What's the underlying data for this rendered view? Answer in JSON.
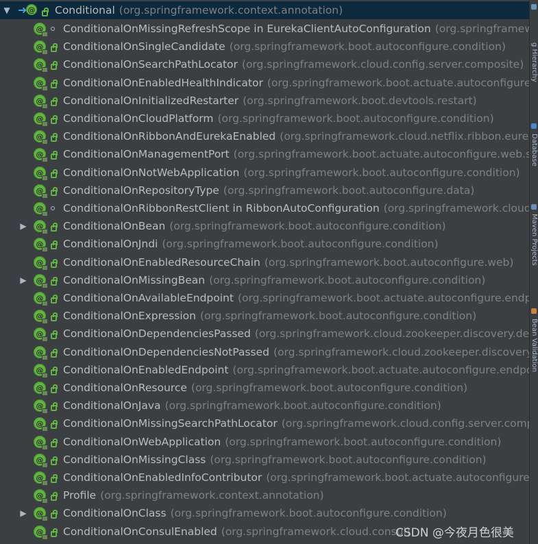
{
  "root": {
    "name": "Conditional",
    "package": "(org.springframework.context.annotation)"
  },
  "items": [
    {
      "name": "ConditionalOnMissingRefreshScope in EurekaClientAutoConfiguration",
      "package": "(org.springframework.c",
      "kind": "class",
      "expandable": false
    },
    {
      "name": "ConditionalOnSingleCandidate",
      "package": "(org.springframework.boot.autoconfigure.condition)",
      "kind": "annotation",
      "expandable": false
    },
    {
      "name": "ConditionalOnSearchPathLocator",
      "package": "(org.springframework.cloud.config.server.composite)",
      "kind": "annotation",
      "expandable": false
    },
    {
      "name": "ConditionalOnEnabledHealthIndicator",
      "package": "(org.springframework.boot.actuate.autoconfigure.healt",
      "kind": "annotation",
      "expandable": false
    },
    {
      "name": "ConditionalOnInitializedRestarter",
      "package": "(org.springframework.boot.devtools.restart)",
      "kind": "annotation",
      "expandable": false
    },
    {
      "name": "ConditionalOnCloudPlatform",
      "package": "(org.springframework.boot.autoconfigure.condition)",
      "kind": "annotation",
      "expandable": false
    },
    {
      "name": "ConditionalOnRibbonAndEurekaEnabled",
      "package": "(org.springframework.cloud.netflix.ribbon.eureka)",
      "kind": "annotation",
      "expandable": false
    },
    {
      "name": "ConditionalOnManagementPort",
      "package": "(org.springframework.boot.actuate.autoconfigure.web.server",
      "kind": "annotation",
      "expandable": false
    },
    {
      "name": "ConditionalOnNotWebApplication",
      "package": "(org.springframework.boot.autoconfigure.condition)",
      "kind": "annotation",
      "expandable": false
    },
    {
      "name": "ConditionalOnRepositoryType",
      "package": "(org.springframework.boot.autoconfigure.data)",
      "kind": "annotation",
      "expandable": false
    },
    {
      "name": "ConditionalOnRibbonRestClient in RibbonAutoConfiguration",
      "package": "(org.springframework.cloud.netf",
      "kind": "class",
      "expandable": false
    },
    {
      "name": "ConditionalOnBean",
      "package": "(org.springframework.boot.autoconfigure.condition)",
      "kind": "annotation",
      "expandable": true
    },
    {
      "name": "ConditionalOnJndi",
      "package": "(org.springframework.boot.autoconfigure.condition)",
      "kind": "annotation",
      "expandable": false
    },
    {
      "name": "ConditionalOnEnabledResourceChain",
      "package": "(org.springframework.boot.autoconfigure.web)",
      "kind": "annotation",
      "expandable": false
    },
    {
      "name": "ConditionalOnMissingBean",
      "package": "(org.springframework.boot.autoconfigure.condition)",
      "kind": "annotation",
      "expandable": true
    },
    {
      "name": "ConditionalOnAvailableEndpoint",
      "package": "(org.springframework.boot.actuate.autoconfigure.endpoint.c",
      "kind": "annotation",
      "expandable": false
    },
    {
      "name": "ConditionalOnExpression",
      "package": "(org.springframework.boot.autoconfigure.condition)",
      "kind": "annotation",
      "expandable": false
    },
    {
      "name": "ConditionalOnDependenciesPassed",
      "package": "(org.springframework.cloud.zookeeper.discovery.depend",
      "kind": "annotation",
      "expandable": false
    },
    {
      "name": "ConditionalOnDependenciesNotPassed",
      "package": "(org.springframework.cloud.zookeeper.discovery.dep",
      "kind": "annotation",
      "expandable": false
    },
    {
      "name": "ConditionalOnEnabledEndpoint",
      "package": "(org.springframework.boot.actuate.autoconfigure.endpoint.c",
      "kind": "annotation",
      "expandable": false
    },
    {
      "name": "ConditionalOnResource",
      "package": "(org.springframework.boot.autoconfigure.condition)",
      "kind": "annotation",
      "expandable": false
    },
    {
      "name": "ConditionalOnJava",
      "package": "(org.springframework.boot.autoconfigure.condition)",
      "kind": "annotation",
      "expandable": false
    },
    {
      "name": "ConditionalOnMissingSearchPathLocator",
      "package": "(org.springframework.cloud.config.server.composite",
      "kind": "annotation",
      "expandable": false
    },
    {
      "name": "ConditionalOnWebApplication",
      "package": "(org.springframework.boot.autoconfigure.condition)",
      "kind": "annotation",
      "expandable": false
    },
    {
      "name": "ConditionalOnMissingClass",
      "package": "(org.springframework.boot.autoconfigure.condition)",
      "kind": "annotation",
      "expandable": false
    },
    {
      "name": "ConditionalOnEnabledInfoContributor",
      "package": "(org.springframework.boot.actuate.autoconfigure.info)",
      "kind": "annotation",
      "expandable": false
    },
    {
      "name": "Profile",
      "package": "(org.springframework.context.annotation)",
      "kind": "annotation",
      "expandable": false
    },
    {
      "name": "ConditionalOnClass",
      "package": "(org.springframework.boot.autoconfigure.condition)",
      "kind": "annotation",
      "expandable": true
    },
    {
      "name": "ConditionalOnConsulEnabled",
      "package": "(org.springframework.cloud.consul)",
      "kind": "annotation",
      "expandable": false
    }
  ],
  "side_tabs": [
    {
      "label": "g Hierarchy"
    },
    {
      "label": "Database"
    },
    {
      "label": "Maven Projects"
    },
    {
      "label": "Bean Validation"
    }
  ],
  "watermark": "CSDN @今夜月色很美",
  "colors": {
    "selection": "#0d293e",
    "annotation_icon": "#62b543",
    "text": "#bbbbbb",
    "package_text": "#808080",
    "background": "#3c3f41"
  }
}
